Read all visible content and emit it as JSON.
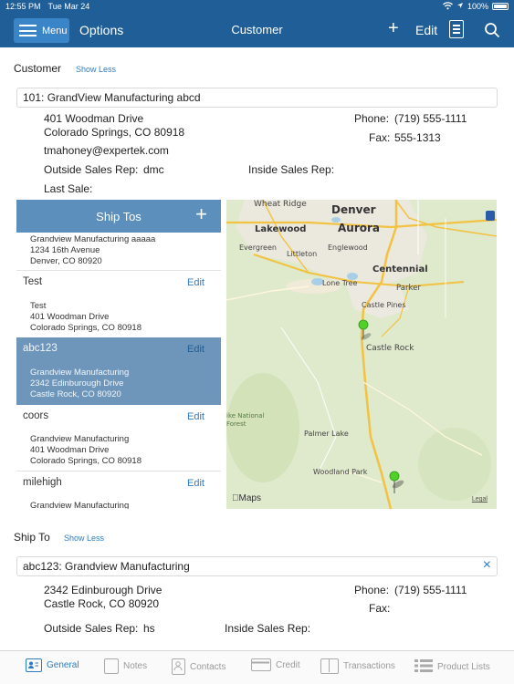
{
  "status_bar": {
    "time": "12:55 PM",
    "date": "Tue Mar 24",
    "battery": "100%"
  },
  "nav": {
    "menu_label": "Menu",
    "options_label": "Options",
    "title": "Customer",
    "add_label": "+",
    "edit_label": "Edit"
  },
  "customer": {
    "section_title": "Customer",
    "show_less": "Show Less",
    "selected": "101: GrandView Manufacturing abcd",
    "address_line1": "401 Woodman Drive",
    "address_line2": "Colorado Springs, CO 80918",
    "email": "tmahoney@expertek.com",
    "phone_label": "Phone:",
    "phone": "(719) 555-1111",
    "fax_label": "Fax:",
    "fax": "555-1313",
    "outside_rep_label": "Outside Sales Rep:",
    "outside_rep": "dmc",
    "inside_rep_label": "Inside Sales Rep:",
    "inside_rep": "",
    "last_sale_label": "Last Sale:",
    "last_sale": ""
  },
  "ship_tos": {
    "header": "Ship Tos",
    "add_icon": "+",
    "edit_label": "Edit",
    "items": [
      {
        "name": "",
        "lines": [
          "Grandview Manufacturing aaaaa",
          "1234 16th Avenue",
          "Denver, CO 80920"
        ],
        "has_edit": false,
        "selected": false
      },
      {
        "name": "Test",
        "lines": [
          "Test",
          "401 Woodman Drive",
          "Colorado Springs, CO 80918"
        ],
        "has_edit": true,
        "selected": false
      },
      {
        "name": "abc123",
        "lines": [
          "Grandview Manufacturing",
          "2342 Edinburough Drive",
          "Castle Rock, CO 80920"
        ],
        "has_edit": true,
        "selected": true
      },
      {
        "name": "coors",
        "lines": [
          "Grandview Manufacturing",
          "401 Woodman Drive",
          "Colorado Springs, CO 80918"
        ],
        "has_edit": true,
        "selected": false
      },
      {
        "name": "milehigh",
        "lines": [
          "Grandview Manufacturing"
        ],
        "has_edit": true,
        "selected": false
      }
    ]
  },
  "map": {
    "labels": {
      "wheat_ridge": "Wheat Ridge",
      "denver": "Denver",
      "aurora": "Aurora",
      "lakewood": "Lakewood",
      "evergreen": "Evergreen",
      "englewood": "Englewood",
      "littleton": "Littleton",
      "centennial": "Centennial",
      "lone_tree": "Lone Tree",
      "parker": "Parker",
      "castle_pines": "Castle Pines",
      "castle_rock": "Castle Rock",
      "pike_forest": "ike National\nForest",
      "palmer_lake": "Palmer Lake",
      "woodland_park": "Woodland Park"
    },
    "brand": "Maps",
    "legal": "Legal"
  },
  "ship_to": {
    "section_title": "Ship To",
    "show_less": "Show Less",
    "selected": "abc123: Grandview Manufacturing",
    "clear_icon": "×",
    "address_line1": "2342 Edinburough Drive",
    "address_line2": "Castle Rock, CO 80920",
    "phone_label": "Phone:",
    "phone": "(719) 555-1111",
    "fax_label": "Fax:",
    "fax": "",
    "outside_rep_label": "Outside Sales Rep:",
    "outside_rep": "hs",
    "inside_rep_label": "Inside Sales Rep:",
    "inside_rep": ""
  },
  "tabs": [
    {
      "label": "General",
      "icon": "contact-card-icon",
      "active": true
    },
    {
      "label": "Notes",
      "icon": "note-icon",
      "active": false
    },
    {
      "label": "Contacts",
      "icon": "person-icon",
      "active": false
    },
    {
      "label": "Credit",
      "icon": "credit-card-icon",
      "active": false
    },
    {
      "label": "Transactions",
      "icon": "columns-icon",
      "active": false
    },
    {
      "label": "Product Lists",
      "icon": "list-icon",
      "active": false
    }
  ],
  "colors": {
    "nav_bg": "#1f5e96",
    "accent": "#2f7bbf",
    "selected_row": "#6e96bb",
    "pin": "#4fd12a"
  }
}
